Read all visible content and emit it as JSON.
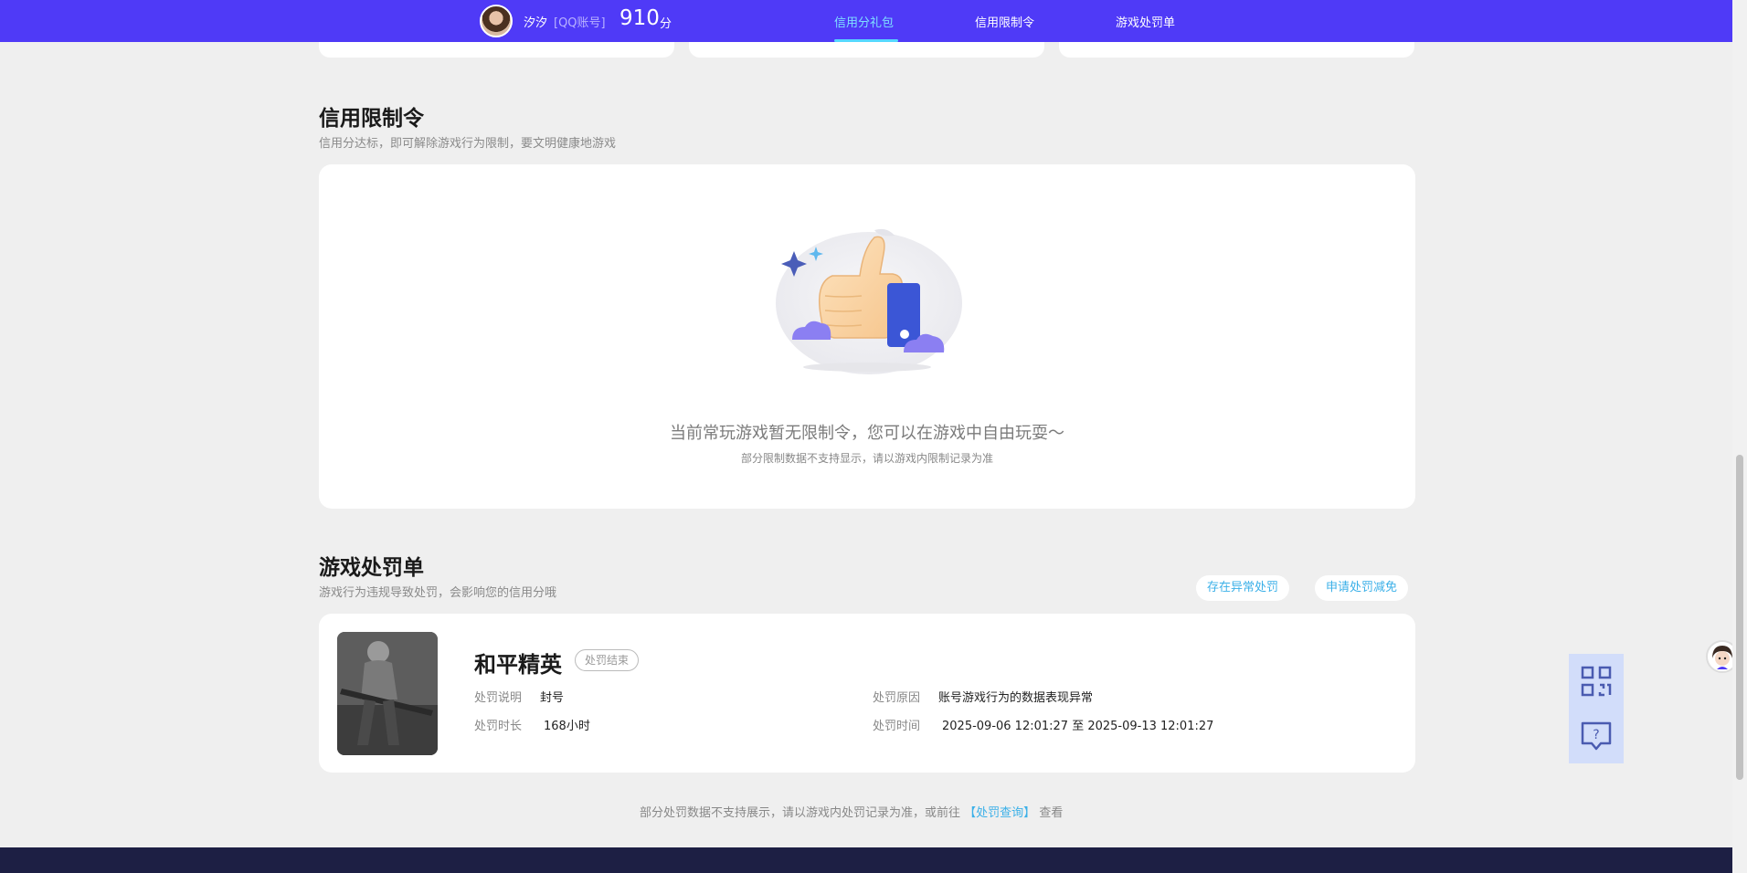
{
  "header": {
    "username": "汐汐",
    "account_type": "[QQ账号]",
    "score": "910",
    "score_unit": "分",
    "tabs": [
      {
        "label": "信用分礼包",
        "active": true
      },
      {
        "label": "信用限制令",
        "active": false
      },
      {
        "label": "游戏处罚单",
        "active": false
      }
    ]
  },
  "restriction": {
    "title": "信用限制令",
    "subtitle": "信用分达标，即可解除游戏行为限制，要文明健康地游戏",
    "empty_message": "当前常玩游戏暂无限制令，您可以在游戏中自由玩耍～",
    "empty_note": "部分限制数据不支持显示，请以游戏内限制记录为准"
  },
  "penalty": {
    "title": "游戏处罚单",
    "subtitle": "游戏行为违规导致处罚，会影响您的信用分哦",
    "buttons": {
      "abnormal": "存在异常处罚",
      "appeal": "申请处罚减免"
    },
    "record": {
      "game_name": "和平精英",
      "status": "处罚结束",
      "desc_label": "处罚说明",
      "desc_value": "封号",
      "duration_label": "处罚时长",
      "duration_value": "168小时",
      "reason_label": "处罚原因",
      "reason_value": "账号游戏行为的数据表现异常",
      "time_label": "处罚时间",
      "time_value": "2025-09-06 12:01:27 至 2025-09-13 12:01:27"
    },
    "footer_prefix": "部分处罚数据不支持展示，请以游戏内处罚记录为准，或前往",
    "footer_link": "【处罚查询】",
    "footer_suffix": "查看"
  },
  "colors": {
    "nav_bg": "#4f3af7",
    "accent_link": "#3bb0e8",
    "active_tab": "#7fe0ff",
    "footer_bg": "#1d1f44"
  },
  "icons": [
    "qr-code-icon",
    "help-chat-icon",
    "assistant-avatar-icon",
    "thumbs-up-illustration"
  ]
}
